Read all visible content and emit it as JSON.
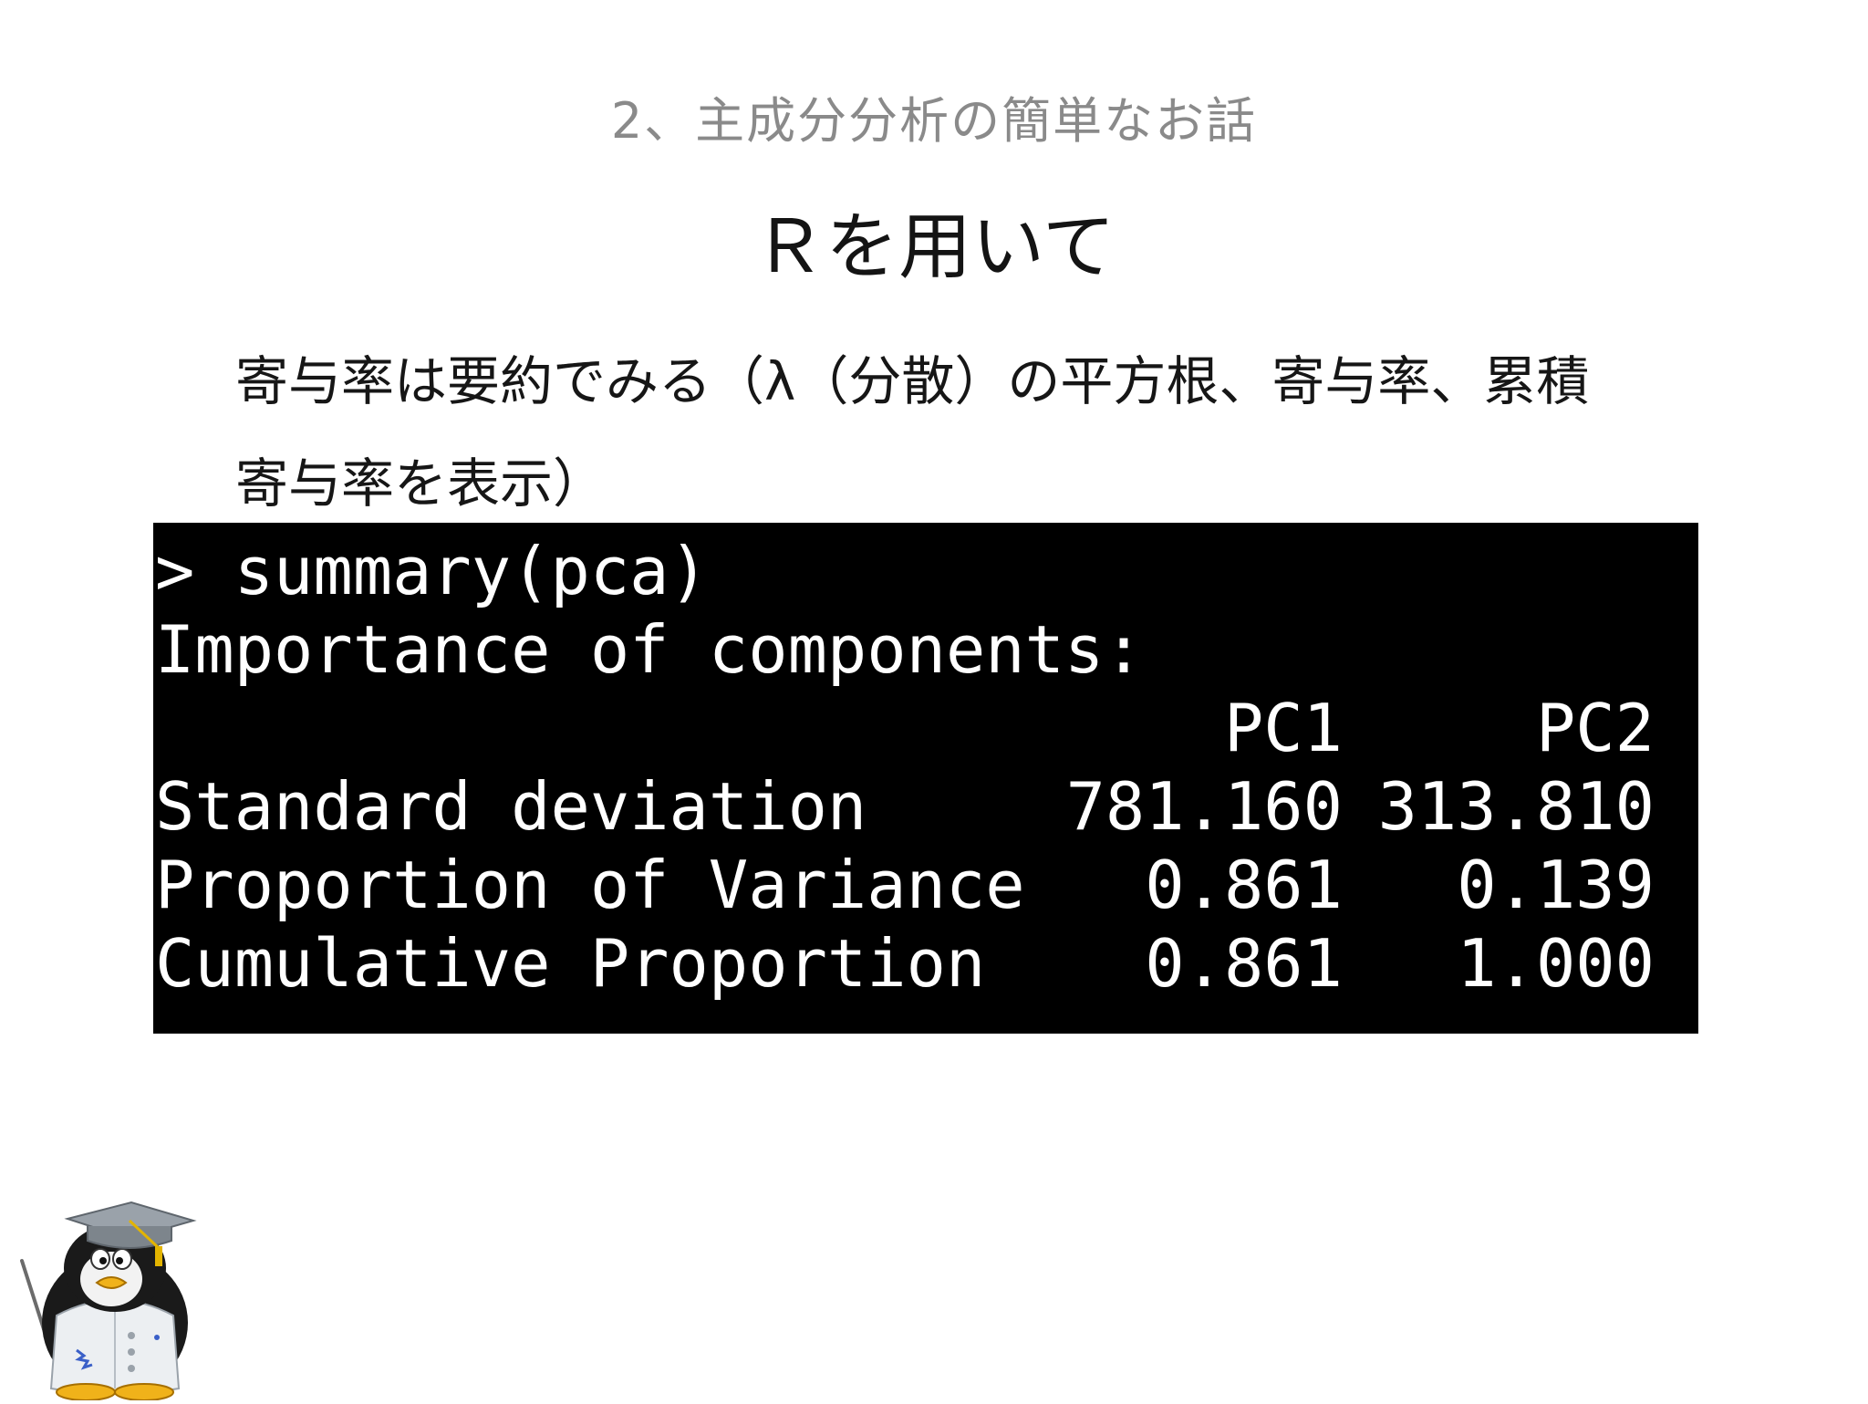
{
  "slide": {
    "heading": "2、主成分分析の簡単なお話",
    "title": "Ｒを用いて",
    "body_line1": "寄与率は要約でみる（λ（分散）の平方根、寄与率、累積",
    "body_line2": "寄与率を表示）"
  },
  "terminal": {
    "command": "> summary(pca)",
    "section_header": "Importance of components:",
    "columns": [
      "PC1",
      "PC2"
    ],
    "rows": [
      {
        "label": "Standard deviation",
        "values": [
          "781.160",
          "313.810"
        ]
      },
      {
        "label": "Proportion of Variance",
        "values": [
          "0.861",
          "0.139"
        ]
      },
      {
        "label": "Cumulative Proportion",
        "values": [
          "0.861",
          "1.000"
        ]
      }
    ]
  },
  "mascot": {
    "icon": "graduate-penguin-icon"
  }
}
